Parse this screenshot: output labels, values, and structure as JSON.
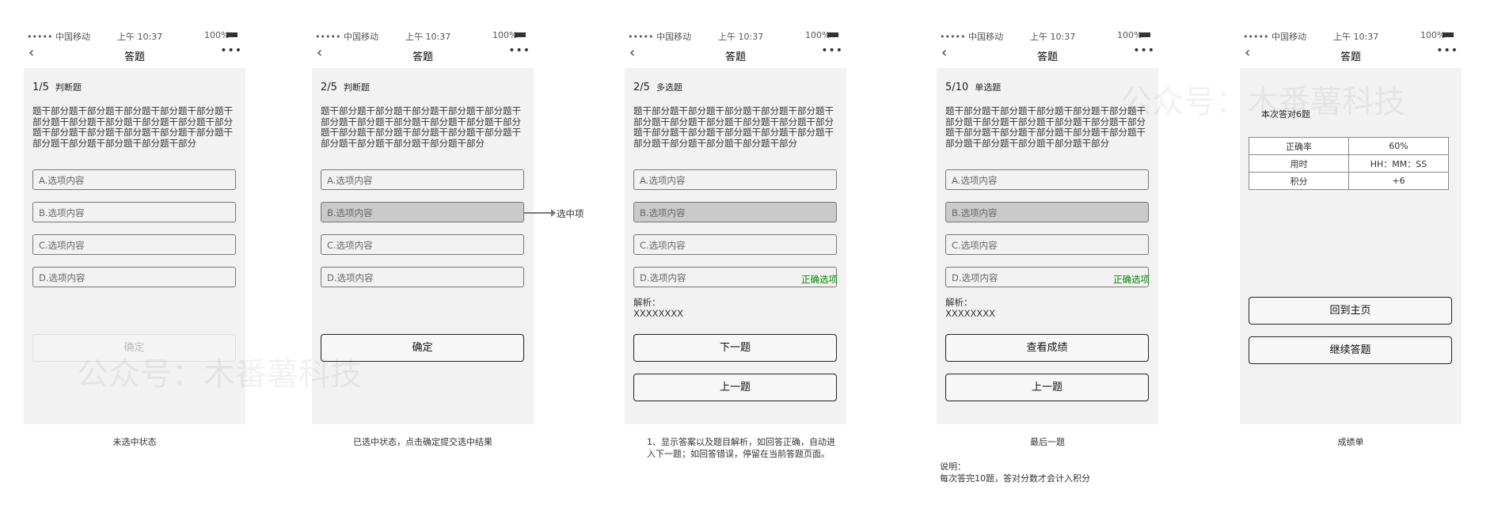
{
  "status": {
    "signal": "••••• 中国移动",
    "time": "上午 10:37",
    "battery": "100%"
  },
  "nav": {
    "back": "‹",
    "title": "答题",
    "more": "•••"
  },
  "stem": "题干部分题干部分题干部分题干部分题干部分题干部分题干部分题干部分题干部分题干部分题干部分题干部分题干部分题干部分题干部分题干部分题干部分题干部分题干部分题干部分题干部分",
  "options": [
    "A.选项内容",
    "B.选项内容",
    "C.选项内容",
    "D.选项内容"
  ],
  "correct_label": "正确选项",
  "analysis": {
    "label": "解析：",
    "text": "XXXXXXXX"
  },
  "watermark": "公众号：木番薯科技",
  "arrow_label": "选中项",
  "screens": [
    {
      "num": "1/5",
      "type": "判断题",
      "selected": -1,
      "buttons": [
        {
          "label": "确定",
          "disabled": true
        }
      ],
      "caption": "未选中状态"
    },
    {
      "num": "2/5",
      "type": "判断题",
      "selected": 1,
      "buttons": [
        {
          "label": "确定"
        }
      ],
      "caption": "已选中状态，点击确定提交选中结果"
    },
    {
      "num": "2/5",
      "type": "多选题",
      "selected": 1,
      "correct": 3,
      "analysis": true,
      "buttons": [
        {
          "label": "下一题"
        },
        {
          "label": "上一题"
        }
      ],
      "caption": "1、显示答案以及题目解析，如回答正确，自动进入下一题；如回答错误，停留在当前答题页面。"
    },
    {
      "num": "5/10",
      "type": "单选题",
      "selected": 1,
      "correct": 3,
      "analysis": true,
      "buttons": [
        {
          "label": "查看成绩"
        },
        {
          "label": "上一题"
        }
      ],
      "caption": "最后一题",
      "note_title": "说明：",
      "note": "每次答完10题，答对分数才会计入积分"
    }
  ],
  "result": {
    "summary": "本次答对6题",
    "rows": [
      [
        "正确率",
        "60%"
      ],
      [
        "用时",
        "HH：MM：SS"
      ],
      [
        "积分",
        "+6"
      ]
    ],
    "buttons": [
      "回到主页",
      "继续答题"
    ],
    "caption": "成绩单"
  }
}
